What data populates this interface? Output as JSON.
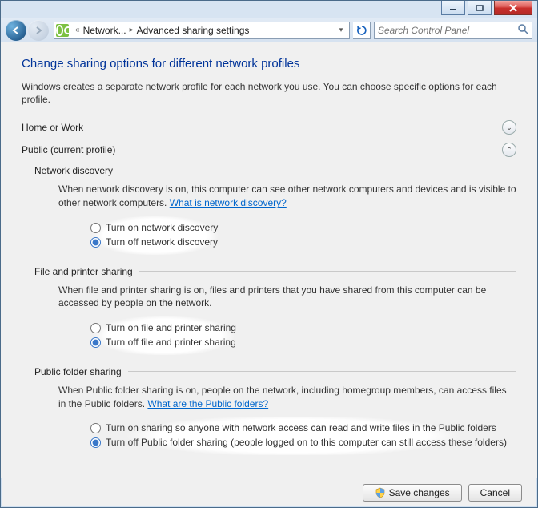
{
  "titlebar": {},
  "nav": {
    "crumb1": "Network...",
    "crumb2": "Advanced sharing settings",
    "search_placeholder": "Search Control Panel"
  },
  "heading": "Change sharing options for different network profiles",
  "intro": "Windows creates a separate network profile for each network you use. You can choose specific options for each profile.",
  "profiles": {
    "home": {
      "label": "Home or Work"
    },
    "public": {
      "label": "Public (current profile)"
    }
  },
  "sections": {
    "discovery": {
      "title": "Network discovery",
      "desc": "When network discovery is on, this computer can see other network computers and devices and is visible to other network computers. ",
      "help": "What is network discovery?",
      "opt_on": "Turn on network discovery",
      "opt_off": "Turn off network discovery"
    },
    "fps": {
      "title": "File and printer sharing",
      "desc": "When file and printer sharing is on, files and printers that you have shared from this computer can be accessed by people on the network.",
      "opt_on": "Turn on file and printer sharing",
      "opt_off": "Turn off file and printer sharing"
    },
    "pfs": {
      "title": "Public folder sharing",
      "desc": "When Public folder sharing is on, people on the network, including homegroup members, can access files in the Public folders. ",
      "help": "What are the Public folders?",
      "opt_on": "Turn on sharing so anyone with network access can read and write files in the Public folders",
      "opt_off": "Turn off Public folder sharing (people logged on to this computer can still access these folders)"
    }
  },
  "buttons": {
    "save": "Save changes",
    "cancel": "Cancel"
  }
}
